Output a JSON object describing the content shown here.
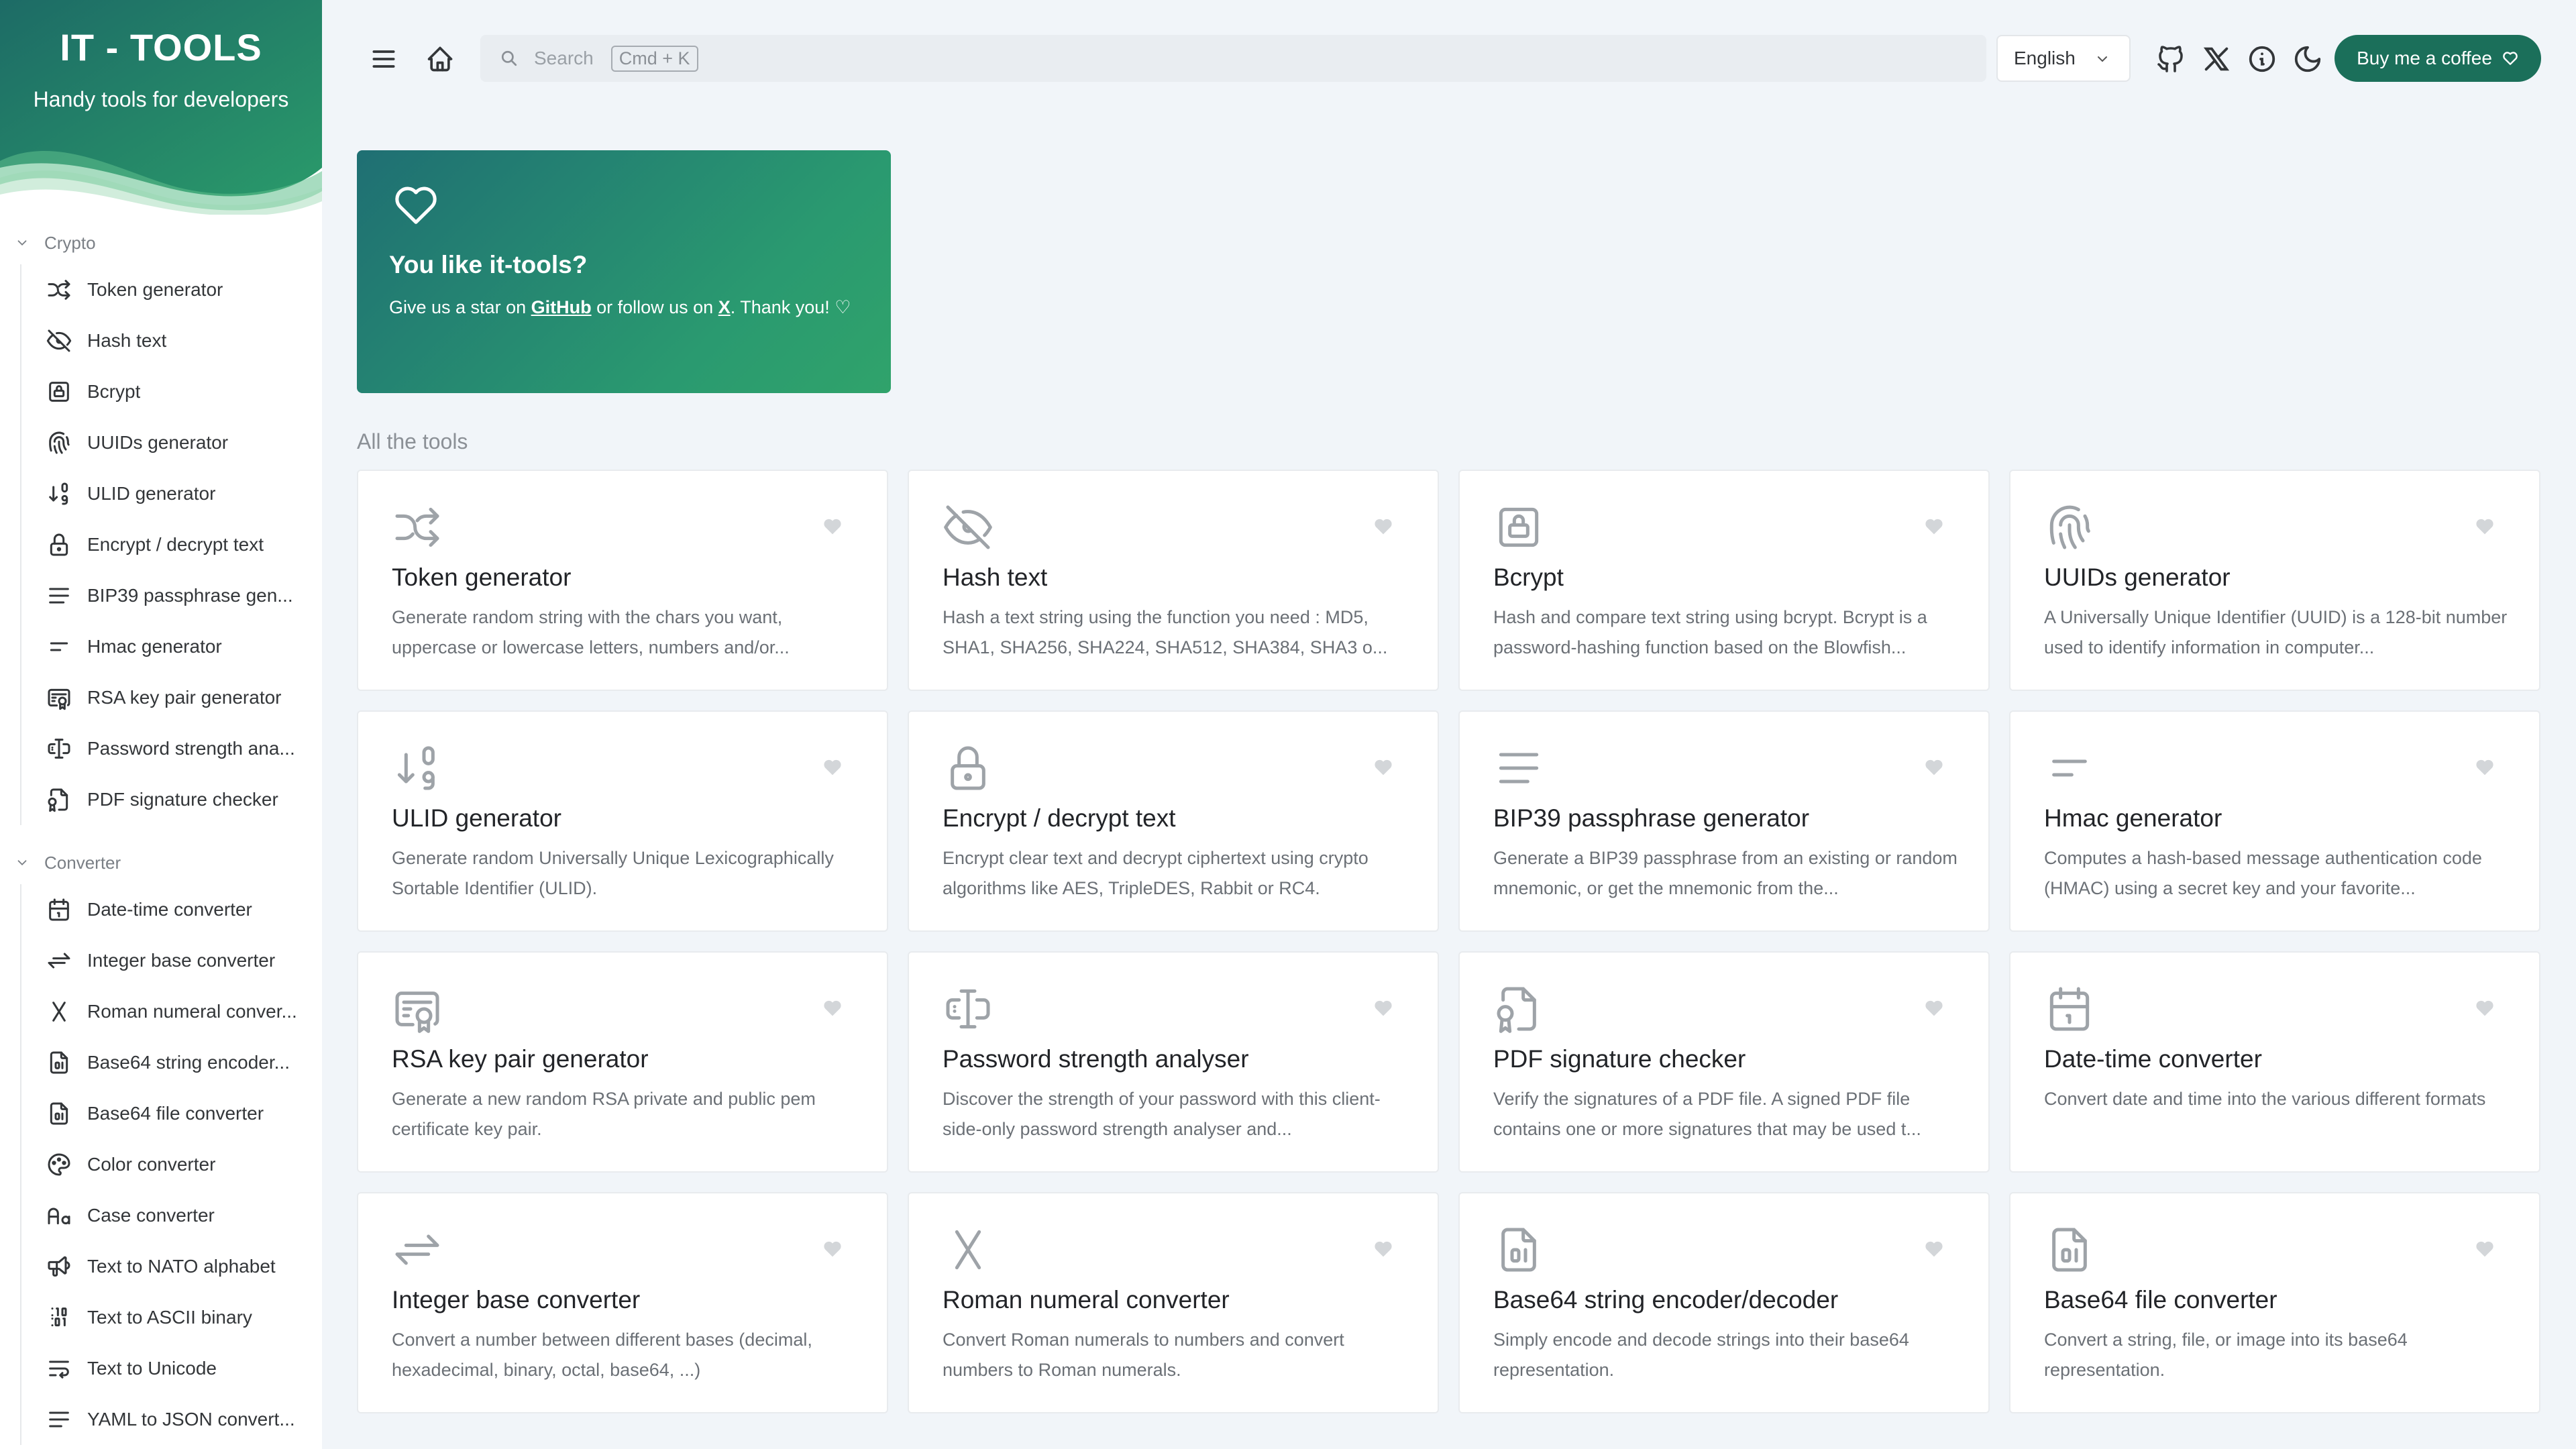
{
  "brand": {
    "title": "IT - TOOLS",
    "subtitle": "Handy tools for developers"
  },
  "sidebar": {
    "sections": [
      {
        "label": "Crypto",
        "items": [
          {
            "label": "Token generator",
            "icon": "shuffle-icon"
          },
          {
            "label": "Hash text",
            "icon": "eye-off-icon"
          },
          {
            "label": "Bcrypt",
            "icon": "lock-square-icon"
          },
          {
            "label": "UUIDs generator",
            "icon": "fingerprint-icon"
          },
          {
            "label": "ULID generator",
            "icon": "sort-numeric-icon"
          },
          {
            "label": "Encrypt / decrypt text",
            "icon": "lock-icon"
          },
          {
            "label": "BIP39 passphrase gen...",
            "icon": "lines-icon"
          },
          {
            "label": "Hmac generator",
            "icon": "short-lines-icon"
          },
          {
            "label": "RSA key pair generator",
            "icon": "certificate-icon"
          },
          {
            "label": "Password strength ana...",
            "icon": "password-icon"
          },
          {
            "label": "PDF signature checker",
            "icon": "file-cert-icon"
          }
        ]
      },
      {
        "label": "Converter",
        "items": [
          {
            "label": "Date-time converter",
            "icon": "calendar-icon"
          },
          {
            "label": "Integer base converter",
            "icon": "arrows-exchange-icon"
          },
          {
            "label": "Roman numeral conver...",
            "icon": "letter-x-icon"
          },
          {
            "label": "Base64 string encoder...",
            "icon": "file-digit-icon"
          },
          {
            "label": "Base64 file converter",
            "icon": "file-digit-icon"
          },
          {
            "label": "Color converter",
            "icon": "palette-icon"
          },
          {
            "label": "Case converter",
            "icon": "letter-case-icon"
          },
          {
            "label": "Text to NATO alphabet",
            "icon": "speakerphone-icon"
          },
          {
            "label": "Text to ASCII binary",
            "icon": "binary-icon"
          },
          {
            "label": "Text to Unicode",
            "icon": "text-wrap-icon"
          },
          {
            "label": "YAML to JSON convert...",
            "icon": "align-left-icon"
          }
        ]
      }
    ]
  },
  "header": {
    "search_placeholder": "Search",
    "search_shortcut": "Cmd + K",
    "language": "English",
    "coffee_label": "Buy me a coffee"
  },
  "promo": {
    "title": "You like it-tools?",
    "text_1": "Give us a star on ",
    "github_link": "GitHub",
    "text_2": " or follow us on ",
    "x_link": "X",
    "text_3": ". Thank you! ♡"
  },
  "all_tools_title": "All the tools",
  "tools": [
    {
      "title": "Token generator",
      "icon": "shuffle-icon",
      "description": "Generate random string with the chars you want, uppercase or lowercase letters, numbers and/or..."
    },
    {
      "title": "Hash text",
      "icon": "eye-off-icon",
      "description": "Hash a text string using the function you need : MD5, SHA1, SHA256, SHA224, SHA512, SHA384, SHA3 o..."
    },
    {
      "title": "Bcrypt",
      "icon": "lock-square-icon",
      "description": "Hash and compare text string using bcrypt. Bcrypt is a password-hashing function based on the Blowfish..."
    },
    {
      "title": "UUIDs generator",
      "icon": "fingerprint-icon",
      "description": "A Universally Unique Identifier (UUID) is a 128-bit number used to identify information in computer..."
    },
    {
      "title": "ULID generator",
      "icon": "sort-numeric-icon",
      "description": "Generate random Universally Unique Lexicographically Sortable Identifier (ULID)."
    },
    {
      "title": "Encrypt / decrypt text",
      "icon": "lock-icon",
      "description": "Encrypt clear text and decrypt ciphertext using crypto algorithms like AES, TripleDES, Rabbit or RC4."
    },
    {
      "title": "BIP39 passphrase generator",
      "icon": "lines-icon",
      "description": "Generate a BIP39 passphrase from an existing or random mnemonic, or get the mnemonic from the..."
    },
    {
      "title": "Hmac generator",
      "icon": "short-lines-icon",
      "description": "Computes a hash-based message authentication code (HMAC) using a secret key and your favorite..."
    },
    {
      "title": "RSA key pair generator",
      "icon": "certificate-icon",
      "description": "Generate a new random RSA private and public pem certificate key pair."
    },
    {
      "title": "Password strength analyser",
      "icon": "password-icon",
      "description": "Discover the strength of your password with this client-side-only password strength analyser and..."
    },
    {
      "title": "PDF signature checker",
      "icon": "file-cert-icon",
      "description": "Verify the signatures of a PDF file. A signed PDF file contains one or more signatures that may be used t..."
    },
    {
      "title": "Date-time converter",
      "icon": "calendar-icon",
      "description": "Convert date and time into the various different formats"
    },
    {
      "title": "Integer base converter",
      "icon": "arrows-exchange-icon",
      "description": "Convert a number between different bases (decimal, hexadecimal, binary, octal, base64, ...)"
    },
    {
      "title": "Roman numeral converter",
      "icon": "letter-x-icon",
      "description": "Convert Roman numerals to numbers and convert numbers to Roman numerals."
    },
    {
      "title": "Base64 string encoder/decoder",
      "icon": "file-digit-icon",
      "description": "Simply encode and decode strings into their base64 representation."
    },
    {
      "title": "Base64 file converter",
      "icon": "file-digit-icon",
      "description": "Convert a string, file, or image into its base64 representation."
    }
  ],
  "colors": {
    "accent": "#1b6f5a",
    "promo_start": "#1f6f73",
    "promo_end": "#30a36b",
    "page_bg": "#f1f5f9"
  }
}
